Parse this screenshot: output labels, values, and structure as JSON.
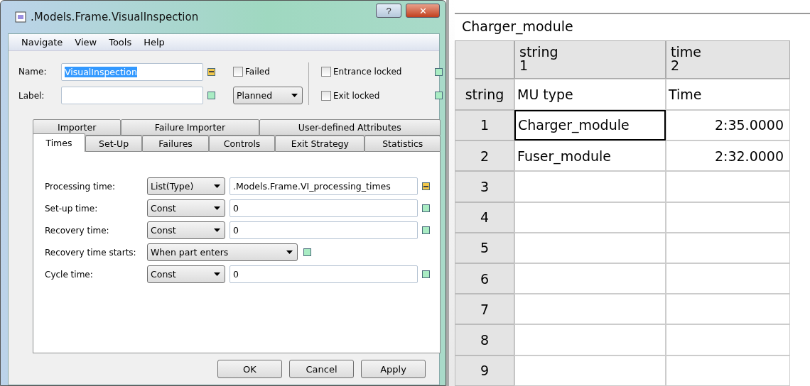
{
  "window": {
    "title": ".Models.Frame.VisualInspection",
    "help": "?",
    "close": "✕"
  },
  "menu": [
    "Navigate",
    "View",
    "Tools",
    "Help"
  ],
  "name_field": {
    "label": "Name:",
    "value": "VisualInspection",
    "text_selected": true,
    "inherited": false
  },
  "label_field": {
    "label": "Label:",
    "inherited": true
  },
  "failed": {
    "label": "Failed",
    "checked": false
  },
  "planned": {
    "value": "Planned"
  },
  "entrance_locked": {
    "label": "Entrance locked",
    "checked": false,
    "inherited": true
  },
  "exit_locked": {
    "label": "Exit locked",
    "checked": false,
    "inherited": true
  },
  "tab_rows": [
    [
      {
        "label": "Importer",
        "selected": false
      },
      {
        "label": "Failure Importer",
        "selected": false
      },
      {
        "label": "User-defined Attributes",
        "selected": false
      }
    ],
    [
      {
        "label": "Times",
        "selected": true
      },
      {
        "label": "Set-Up",
        "selected": false
      },
      {
        "label": "Failures",
        "selected": false
      },
      {
        "label": "Controls",
        "selected": false
      },
      {
        "label": "Exit Strategy",
        "selected": false
      },
      {
        "label": "Statistics",
        "selected": false
      }
    ]
  ],
  "time_settings": [
    {
      "label": "Processing time:",
      "mode": "List(Type)",
      "value": ".Models.Frame.VI_processing_times",
      "inherited": false
    },
    {
      "label": "Set-up time:",
      "mode": "Const",
      "value": "0",
      "inherited": true
    },
    {
      "label": "Recovery time:",
      "mode": "Const",
      "value": "0",
      "inherited": true
    },
    {
      "label": "Recovery time starts:",
      "mode": "When part enters",
      "inherited": true
    },
    {
      "label": "Cycle time:",
      "mode": "Const",
      "value": "0",
      "inherited": true
    }
  ],
  "buttons": [
    "OK",
    "Cancel",
    "Apply"
  ],
  "table": {
    "title": "Charger_module",
    "columns": [
      {
        "type": "string",
        "index": "1"
      },
      {
        "type": "time",
        "index": "2"
      }
    ],
    "type_row": {
      "label": "string",
      "cells": [
        "MU type",
        "Time"
      ]
    },
    "rows": [
      {
        "index": "1",
        "cells": [
          {
            "text": "Charger_module",
            "selected": true
          },
          {
            "text": "2:35.0000",
            "selected": false
          }
        ]
      },
      {
        "index": "2",
        "cells": [
          {
            "text": "Fuser_module",
            "selected": false
          },
          {
            "text": "2:32.0000",
            "selected": false
          }
        ]
      },
      {
        "index": "3",
        "cells": []
      },
      {
        "index": "4",
        "cells": []
      },
      {
        "index": "5",
        "cells": []
      },
      {
        "index": "6",
        "cells": []
      },
      {
        "index": "7",
        "cells": []
      },
      {
        "index": "8",
        "cells": []
      },
      {
        "index": "9",
        "cells": []
      }
    ]
  }
}
